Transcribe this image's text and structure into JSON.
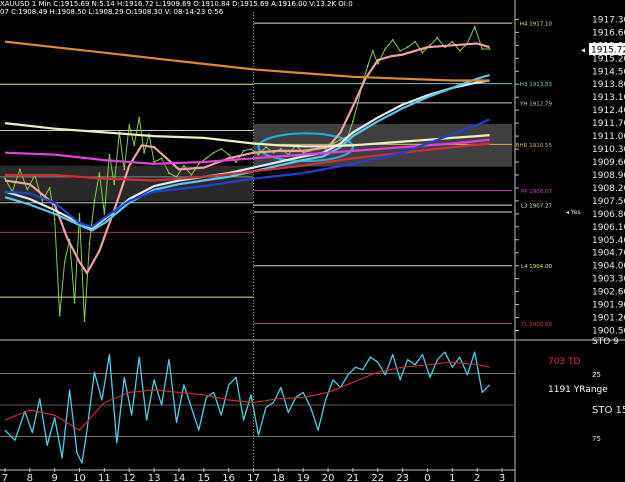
{
  "header": {
    "line1": "XAUUSD  1 Min  C:1915.69  N:5.14  H:1916.72  L:1909.69  O:1910.84  D:1915.69  A:1916.00  V:13.2K  OI:0",
    "line2": "07  C:1908.49  H:1908.50  L:1908.29  O:1908.30  V:  08-14-23  0:56"
  },
  "chart_data": [
    {
      "type": "line",
      "panel": "price",
      "price_axis": {
        "ticks": [
          1917.3,
          1916.6,
          1915.9,
          1915.2,
          1914.5,
          1913.8,
          1913.1,
          1912.4,
          1911.7,
          1911.0,
          1910.3,
          1909.6,
          1908.9,
          1908.2,
          1907.5,
          1906.8,
          1906.1,
          1905.4,
          1904.7,
          1904.0,
          1903.3,
          1902.6,
          1901.9,
          1901.2,
          1900.5
        ],
        "tick_labels": [
          "1917.30",
          "1916.60",
          "1915.90",
          "1915.20",
          "1914.50",
          "1913.80",
          "1913.10",
          "1912.40",
          "1911.70",
          "1911.00",
          "1910.30",
          "1909.60",
          "1908.90",
          "1908.20",
          "1907.50",
          "1906.80",
          "1906.10",
          "1905.40",
          "1904.70",
          "1904.00",
          "1903.30",
          "1902.60",
          "1901.90",
          "1901.20",
          "1900.50"
        ],
        "ylim": [
          1900.15,
          1917.7
        ],
        "current_price_label": "1915.72",
        "last_axis_label_partial": "STO 9"
      },
      "x_axis": {
        "tick_labels": [
          "7",
          "8",
          "9",
          "10",
          "11",
          "12",
          "13",
          "14",
          "15",
          "16",
          "17",
          "18",
          "19",
          "20",
          "21",
          "22",
          "23",
          "0",
          "1",
          "2",
          "3"
        ],
        "positions": [
          0,
          1,
          2,
          3,
          4,
          5,
          6,
          7,
          8,
          9,
          10,
          11,
          12,
          13,
          14,
          15,
          16,
          17,
          18,
          19,
          20
        ],
        "xlim": [
          -0.2,
          20.4
        ],
        "session_divider_at": 10
      },
      "levels": [
        {
          "label": "H4 1917.10",
          "value": 1917.1,
          "color": "#f0e27a",
          "x_start": 10
        },
        {
          "label": "H3 1913.83",
          "value": 1913.83,
          "color": "#6fc8c8",
          "x_start": 10
        },
        {
          "label": "YH 1912.79",
          "value": 1912.79,
          "color": "#d0d0d0",
          "x_start": 10
        },
        {
          "label": "BHR 1910.55",
          "value": 1910.55,
          "color": "#d8b060",
          "x_start": 10
        },
        {
          "label": "PP 1908.07",
          "value": 1908.07,
          "color": "#d040d0",
          "x_start": 10
        },
        {
          "label": "L3 1907.27",
          "value": 1907.27,
          "color": "#e0e0e0",
          "x_start": 10
        },
        {
          "label": "L4 1904.00",
          "value": 1904.0,
          "color": "#f0e27a",
          "x_start": 10
        },
        {
          "label": "YL 1900.88",
          "value": 1900.88,
          "color": "#d04040",
          "x_start": 10
        },
        {
          "label": "",
          "value": 1913.8,
          "color": "#f0e27a",
          "x_start": -0.2,
          "x_end": 10
        },
        {
          "label": "",
          "value": 1911.3,
          "color": "#c8c8c8",
          "x_start": -0.2,
          "x_end": 10
        },
        {
          "label": "",
          "value": 1908.8,
          "color": "#888888",
          "x_start": -0.2,
          "x_end": 10
        },
        {
          "label": "",
          "value": 1907.4,
          "color": "#c8c8c8",
          "x_start": -0.2,
          "x_end": 10
        },
        {
          "label": "",
          "value": 1905.8,
          "color": "#a04040",
          "x_start": -0.2,
          "x_end": 10
        },
        {
          "label": "",
          "value": 1902.3,
          "color": "#f0e27a",
          "x_start": -0.2,
          "x_end": 10
        },
        {
          "label": "",
          "value": 1906.9,
          "color": "#e0e0e0",
          "x_start": 10
        }
      ],
      "zone": {
        "from": 1909.35,
        "to": 1911.65,
        "color": "#5a5a5a"
      },
      "left_zone": {
        "from": 1907.5,
        "to": 1909.4,
        "color": "#4a4a4a",
        "x_end": 10
      },
      "annotations": [
        {
          "text": "Yes",
          "value": 1906.95,
          "color": "#e0e0e0"
        }
      ],
      "ellipse": {
        "x": 12.1,
        "y": 1910.4,
        "rx": 1.9,
        "ry": 0.75,
        "color": "#29a8d8"
      },
      "series": [
        {
          "name": "",
          "style": "price",
          "color": "#7fd04a",
          "x": [
            0,
            0.3,
            0.6,
            0.9,
            1.2,
            1.5,
            1.8,
            2.0,
            2.2,
            2.4,
            2.6,
            2.8,
            3.0,
            3.2,
            3.4,
            3.6,
            3.8,
            4.0,
            4.2,
            4.4,
            4.6,
            4.8,
            5.0,
            5.2,
            5.4,
            5.6,
            5.8,
            6.0,
            6.3,
            6.6,
            6.9,
            7.2,
            7.5,
            7.8,
            8.1,
            8.4,
            8.7,
            9.0,
            9.3,
            9.6,
            9.9,
            10.2,
            10.5,
            10.8,
            11.1,
            11.4,
            11.7,
            12.0,
            12.3,
            12.6,
            12.9,
            13.2,
            13.5,
            13.8,
            14.0,
            14.2,
            14.4,
            14.6,
            14.8,
            15.0,
            15.3,
            15.6,
            15.9,
            16.2,
            16.5,
            16.8,
            17.1,
            17.4,
            17.7,
            18.0,
            18.3,
            18.6,
            18.9,
            19.2,
            19.5
          ],
          "y": [
            1908.7,
            1908.0,
            1909.2,
            1908.1,
            1908.9,
            1907.5,
            1908.2,
            1906.5,
            1901.3,
            1904.2,
            1905.4,
            1902.0,
            1906.8,
            1901.0,
            1905.2,
            1907.5,
            1909.0,
            1906.8,
            1910.0,
            1908.4,
            1911.2,
            1909.2,
            1911.6,
            1910.5,
            1912.0,
            1910.1,
            1911.1,
            1909.6,
            1909.8,
            1909.0,
            1908.8,
            1909.4,
            1908.9,
            1909.5,
            1909.8,
            1910.1,
            1910.3,
            1910.0,
            1909.6,
            1910.2,
            1910.3,
            1910.0,
            1910.4,
            1910.1,
            1910.3,
            1910.0,
            1910.5,
            1910.1,
            1910.2,
            1910.4,
            1910.3,
            1910.6,
            1910.8,
            1911.0,
            1911.8,
            1912.8,
            1913.9,
            1914.8,
            1915.6,
            1914.9,
            1915.7,
            1916.2,
            1915.6,
            1915.8,
            1916.1,
            1915.5,
            1915.9,
            1916.3,
            1915.8,
            1916.1,
            1915.6,
            1916.0,
            1916.9,
            1915.7,
            1915.7
          ]
        },
        {
          "name": "",
          "style": "ma",
          "color": "#f0a0a0",
          "x": [
            0,
            1,
            2,
            2.5,
            3,
            3.3,
            3.8,
            4.5,
            5,
            5.5,
            6,
            7,
            8,
            9,
            10,
            11,
            12,
            13,
            13.5,
            14,
            14.5,
            15,
            15.5,
            16,
            17,
            18,
            19,
            19.5
          ],
          "y": [
            1908.6,
            1908.4,
            1907.3,
            1905.5,
            1904.2,
            1903.6,
            1904.8,
            1907.4,
            1909.4,
            1910.5,
            1910.4,
            1909.2,
            1909.3,
            1909.8,
            1910.1,
            1910.2,
            1910.2,
            1910.4,
            1911.2,
            1912.6,
            1914.1,
            1915.1,
            1915.3,
            1915.4,
            1915.8,
            1915.9,
            1916.0,
            1915.8
          ]
        },
        {
          "name": "",
          "style": "ma",
          "color": "#e0e8f0",
          "x": [
            0,
            1,
            2,
            3,
            3.5,
            4,
            5,
            6,
            7,
            8,
            9,
            10,
            11,
            12,
            12.8,
            13.5,
            14,
            15,
            16,
            17,
            18,
            19,
            19.5
          ],
          "y": [
            1908.0,
            1907.6,
            1907.0,
            1906.3,
            1906.0,
            1906.5,
            1907.6,
            1908.3,
            1908.6,
            1908.8,
            1909.0,
            1909.3,
            1909.6,
            1909.9,
            1910.1,
            1910.6,
            1911.2,
            1912.0,
            1912.7,
            1913.2,
            1913.6,
            1913.9,
            1914.0
          ]
        },
        {
          "name": "",
          "style": "ma",
          "color": "#5ac8e8",
          "x": [
            0,
            1,
            2,
            3,
            3.5,
            4,
            5,
            6,
            7,
            8,
            9,
            10,
            11,
            12,
            12.8,
            13.5,
            14,
            15,
            16,
            17,
            18,
            19,
            19.5
          ],
          "y": [
            1907.7,
            1907.3,
            1906.8,
            1906.2,
            1905.9,
            1906.3,
            1907.4,
            1908.1,
            1908.4,
            1908.6,
            1908.8,
            1909.1,
            1909.4,
            1909.7,
            1909.9,
            1910.4,
            1911.0,
            1911.8,
            1912.5,
            1913.1,
            1913.6,
            1914.1,
            1914.3
          ]
        },
        {
          "name": "",
          "style": "ma",
          "color": "#f0eec0",
          "x": [
            0,
            2,
            4,
            6,
            8,
            10,
            11,
            12,
            13,
            14,
            15,
            16,
            17,
            18,
            19,
            19.5
          ],
          "y": [
            1911.7,
            1911.4,
            1911.2,
            1911.0,
            1910.9,
            1910.6,
            1910.5,
            1910.45,
            1910.45,
            1910.5,
            1910.6,
            1910.7,
            1910.8,
            1910.9,
            1911.0,
            1911.05
          ]
        },
        {
          "name": "",
          "style": "ma",
          "color": "#e040e0",
          "x": [
            0,
            2,
            4,
            6,
            8,
            10,
            12,
            14,
            16,
            18,
            19.5
          ],
          "y": [
            1910.1,
            1910.0,
            1909.7,
            1909.5,
            1909.6,
            1909.8,
            1910.0,
            1910.2,
            1910.4,
            1910.6,
            1910.8
          ]
        },
        {
          "name": "",
          "style": "ma",
          "color": "#d03030",
          "x": [
            0,
            2,
            4,
            6,
            8,
            10,
            12,
            14,
            16,
            18,
            19.5
          ],
          "y": [
            1908.9,
            1908.9,
            1908.7,
            1908.6,
            1908.8,
            1909.1,
            1909.4,
            1909.8,
            1910.1,
            1910.4,
            1910.6
          ]
        },
        {
          "name": "",
          "style": "ma",
          "color": "#2040d0",
          "x": [
            0,
            1,
            2,
            3,
            3.5,
            4,
            5,
            6,
            8,
            10,
            12,
            14,
            16,
            17,
            18,
            19,
            19.5
          ],
          "y": [
            1908.0,
            1907.9,
            1907.4,
            1906.3,
            1906.1,
            1906.6,
            1907.5,
            1908.0,
            1908.3,
            1908.7,
            1909.0,
            1909.5,
            1910.1,
            1910.6,
            1911.1,
            1911.6,
            1911.9
          ]
        },
        {
          "name": "",
          "style": "ma",
          "color": "#e08a2a",
          "x": [
            0,
            2,
            4,
            6,
            8,
            10,
            12,
            14,
            16,
            18,
            19.5
          ],
          "y": [
            1916.1,
            1915.8,
            1915.5,
            1915.2,
            1914.9,
            1914.6,
            1914.4,
            1914.2,
            1914.1,
            1914.0,
            1914.0
          ]
        }
      ]
    },
    {
      "type": "line",
      "panel": "oscillator",
      "ylim": [
        0,
        100
      ],
      "grid_levels": [
        25,
        75
      ],
      "tick_labels": [
        "25",
        "STO 15",
        "75"
      ],
      "labels": [
        {
          "text": "703 TD",
          "color": "#e03030"
        },
        {
          "text": "1191 YRange",
          "color": "#ffffff"
        }
      ],
      "series": [
        {
          "name": "",
          "color": "#4ad0e8",
          "x": [
            0,
            0.4,
            0.8,
            1.1,
            1.4,
            1.7,
            2.0,
            2.3,
            2.6,
            2.9,
            3.1,
            3.3,
            3.6,
            3.9,
            4.2,
            4.5,
            4.8,
            5.1,
            5.4,
            5.7,
            6.0,
            6.3,
            6.6,
            6.9,
            7.2,
            7.5,
            7.8,
            8.1,
            8.4,
            8.7,
            9.0,
            9.3,
            9.6,
            9.9,
            10.2,
            10.5,
            10.8,
            11.1,
            11.4,
            11.7,
            12.0,
            12.3,
            12.6,
            12.9,
            13.2,
            13.5,
            13.8,
            14.1,
            14.4,
            14.7,
            15.0,
            15.3,
            15.6,
            15.9,
            16.2,
            16.5,
            16.8,
            17.1,
            17.4,
            17.7,
            18.0,
            18.3,
            18.6,
            18.9,
            19.2,
            19.5
          ],
          "y": [
            30,
            22,
            45,
            28,
            55,
            18,
            40,
            8,
            62,
            12,
            4,
            30,
            76,
            54,
            90,
            20,
            72,
            42,
            88,
            38,
            70,
            50,
            86,
            36,
            66,
            48,
            30,
            56,
            60,
            42,
            66,
            72,
            38,
            58,
            26,
            48,
            52,
            64,
            44,
            56,
            60,
            48,
            30,
            54,
            70,
            64,
            74,
            80,
            78,
            88,
            84,
            74,
            90,
            70,
            86,
            82,
            90,
            72,
            86,
            92,
            80,
            88,
            74,
            92,
            60,
            66
          ]
        },
        {
          "name": "",
          "color": "#d02a2a",
          "x": [
            0,
            1,
            2,
            3,
            4,
            5,
            6,
            7,
            8,
            9,
            10,
            11,
            12,
            13,
            14,
            15,
            16,
            17,
            18,
            19,
            19.5
          ],
          "y": [
            38,
            46,
            42,
            30,
            52,
            60,
            62,
            60,
            58,
            54,
            52,
            55,
            56,
            60,
            68,
            76,
            80,
            82,
            84,
            82,
            80
          ]
        }
      ]
    }
  ]
}
